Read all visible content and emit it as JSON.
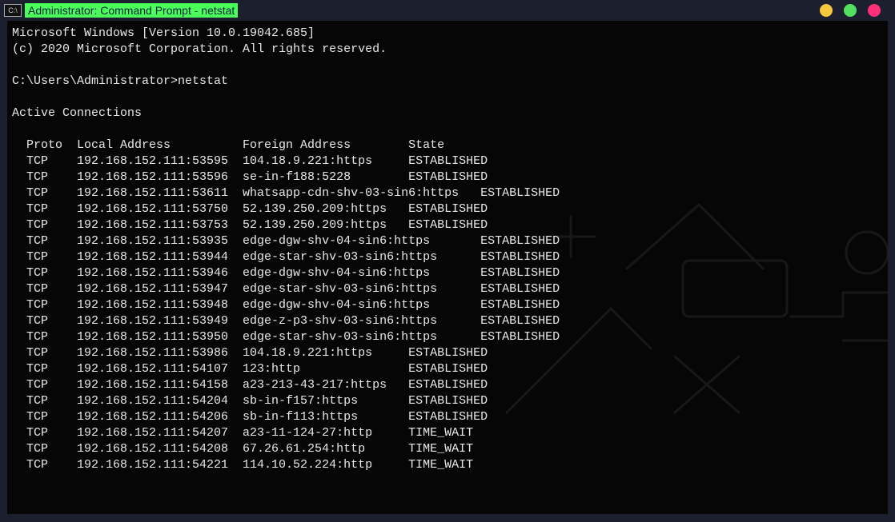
{
  "title": "Administrator: Command Prompt - netstat",
  "banner_line1": "Microsoft Windows [Version 10.0.19042.685]",
  "banner_line2": "(c) 2020 Microsoft Corporation. All rights reserved.",
  "prompt_path": "C:\\Users\\Administrator>",
  "command": "netstat",
  "section_header": "Active Connections",
  "columns": {
    "c0": "Proto",
    "c1": "Local Address",
    "c2": "Foreign Address",
    "c3": "State"
  },
  "rows": [
    {
      "proto": "TCP",
      "local": "192.168.152.111:53595",
      "foreign": "104.18.9.221:https",
      "state": "ESTABLISHED"
    },
    {
      "proto": "TCP",
      "local": "192.168.152.111:53596",
      "foreign": "se-in-f188:5228",
      "state": "ESTABLISHED"
    },
    {
      "proto": "TCP",
      "local": "192.168.152.111:53611",
      "foreign": "whatsapp-cdn-shv-03-sin6:https",
      "state": "ESTABLISHED"
    },
    {
      "proto": "TCP",
      "local": "192.168.152.111:53750",
      "foreign": "52.139.250.209:https",
      "state": "ESTABLISHED"
    },
    {
      "proto": "TCP",
      "local": "192.168.152.111:53753",
      "foreign": "52.139.250.209:https",
      "state": "ESTABLISHED"
    },
    {
      "proto": "TCP",
      "local": "192.168.152.111:53935",
      "foreign": "edge-dgw-shv-04-sin6:https",
      "state": "ESTABLISHED"
    },
    {
      "proto": "TCP",
      "local": "192.168.152.111:53944",
      "foreign": "edge-star-shv-03-sin6:https",
      "state": "ESTABLISHED"
    },
    {
      "proto": "TCP",
      "local": "192.168.152.111:53946",
      "foreign": "edge-dgw-shv-04-sin6:https",
      "state": "ESTABLISHED"
    },
    {
      "proto": "TCP",
      "local": "192.168.152.111:53947",
      "foreign": "edge-star-shv-03-sin6:https",
      "state": "ESTABLISHED"
    },
    {
      "proto": "TCP",
      "local": "192.168.152.111:53948",
      "foreign": "edge-dgw-shv-04-sin6:https",
      "state": "ESTABLISHED"
    },
    {
      "proto": "TCP",
      "local": "192.168.152.111:53949",
      "foreign": "edge-z-p3-shv-03-sin6:https",
      "state": "ESTABLISHED"
    },
    {
      "proto": "TCP",
      "local": "192.168.152.111:53950",
      "foreign": "edge-star-shv-03-sin6:https",
      "state": "ESTABLISHED"
    },
    {
      "proto": "TCP",
      "local": "192.168.152.111:53986",
      "foreign": "104.18.9.221:https",
      "state": "ESTABLISHED"
    },
    {
      "proto": "TCP",
      "local": "192.168.152.111:54107",
      "foreign": "123:http",
      "state": "ESTABLISHED"
    },
    {
      "proto": "TCP",
      "local": "192.168.152.111:54158",
      "foreign": "a23-213-43-217:https",
      "state": "ESTABLISHED"
    },
    {
      "proto": "TCP",
      "local": "192.168.152.111:54204",
      "foreign": "sb-in-f157:https",
      "state": "ESTABLISHED"
    },
    {
      "proto": "TCP",
      "local": "192.168.152.111:54206",
      "foreign": "sb-in-f113:https",
      "state": "ESTABLISHED"
    },
    {
      "proto": "TCP",
      "local": "192.168.152.111:54207",
      "foreign": "a23-11-124-27:http",
      "state": "TIME_WAIT"
    },
    {
      "proto": "TCP",
      "local": "192.168.152.111:54208",
      "foreign": "67.26.61.254:http",
      "state": "TIME_WAIT"
    },
    {
      "proto": "TCP",
      "local": "192.168.152.111:54221",
      "foreign": "114.10.52.224:http",
      "state": "TIME_WAIT"
    }
  ]
}
